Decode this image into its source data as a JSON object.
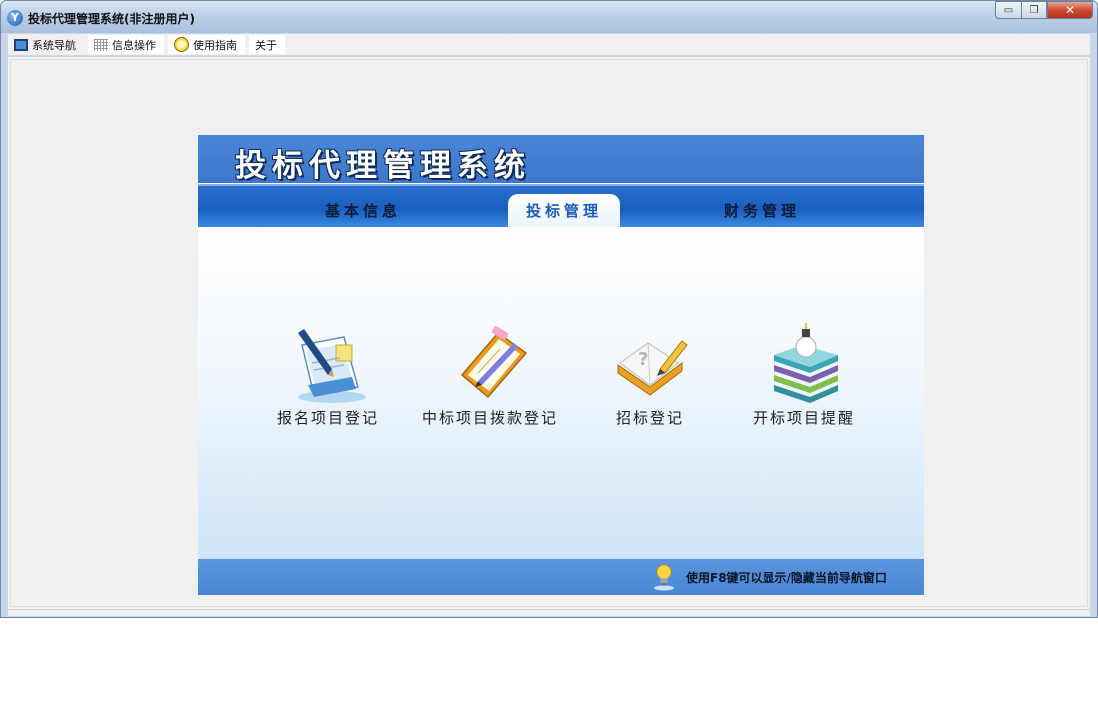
{
  "window": {
    "title": "投标代理管理系统(非注册用户)",
    "controls": {
      "minimize": "▭",
      "restore": "❐",
      "close": "✕"
    }
  },
  "menu": [
    {
      "label": "系统导航",
      "icon": "monitor-icon"
    },
    {
      "label": "信息操作",
      "icon": "grid-icon"
    },
    {
      "label": "使用指南",
      "icon": "sun-icon"
    },
    {
      "label": "关于"
    }
  ],
  "panel": {
    "title": "投标代理管理系统",
    "tabs": [
      {
        "label": "基本信息",
        "active": false
      },
      {
        "label": "投标管理",
        "active": true
      },
      {
        "label": "财务管理",
        "active": false
      }
    ],
    "items": [
      {
        "label": "报名项目登记",
        "icon": "document-pen-icon"
      },
      {
        "label": "中标项目拨款登记",
        "icon": "clipboard-pen-icon"
      },
      {
        "label": "招标登记",
        "icon": "book-pencil-icon"
      },
      {
        "label": "开标项目提醒",
        "icon": "books-lightbulb-icon"
      }
    ],
    "footer_hint": "使用F8键可以显示/隐藏当前导航窗口"
  },
  "colors": {
    "header_blue": "#4a86d8",
    "tab_blue": "#1a5fc0",
    "active_tab_text": "#1a5fb8",
    "client_bg": "#f0f0f0"
  }
}
